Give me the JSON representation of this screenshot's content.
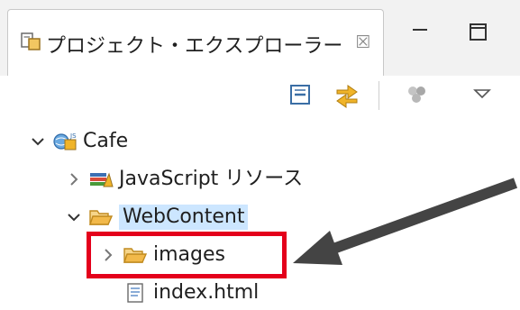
{
  "panel": {
    "title": "プロジェクト・エクスプローラー",
    "close_symbol": "☒"
  },
  "tree": {
    "project": "Cafe",
    "javascript_resources": "JavaScript リソース",
    "webcontent": "WebContent",
    "images": "images",
    "index_file": "index.html"
  },
  "colors": {
    "selection": "#cce6ff",
    "highlight_box": "#e4001b",
    "arrow": "#444444",
    "folder": "#e8a33a"
  }
}
